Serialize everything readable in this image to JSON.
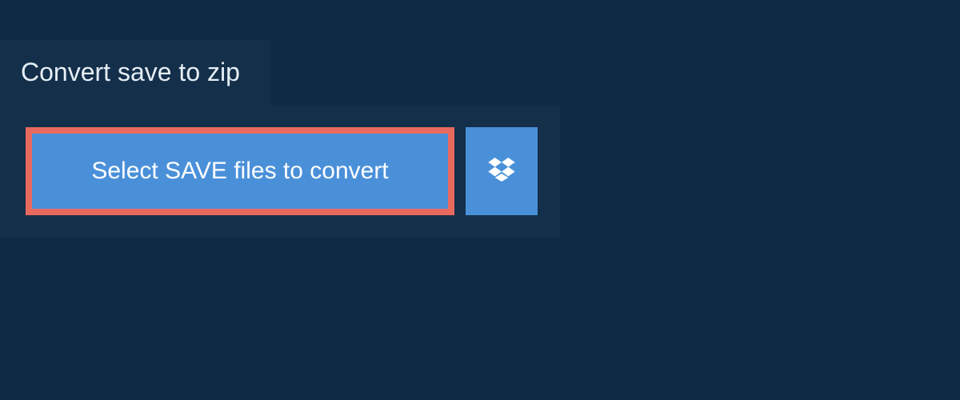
{
  "header": {
    "tab_label": "Convert save to zip"
  },
  "main": {
    "select_button_label": "Select SAVE files to convert",
    "dropbox_icon": "dropbox-icon"
  },
  "colors": {
    "background": "#0f2a44",
    "panel": "#142f4a",
    "button_primary": "#4a90d9",
    "button_border_highlight": "#e86a5f",
    "text_light": "#ffffff"
  }
}
